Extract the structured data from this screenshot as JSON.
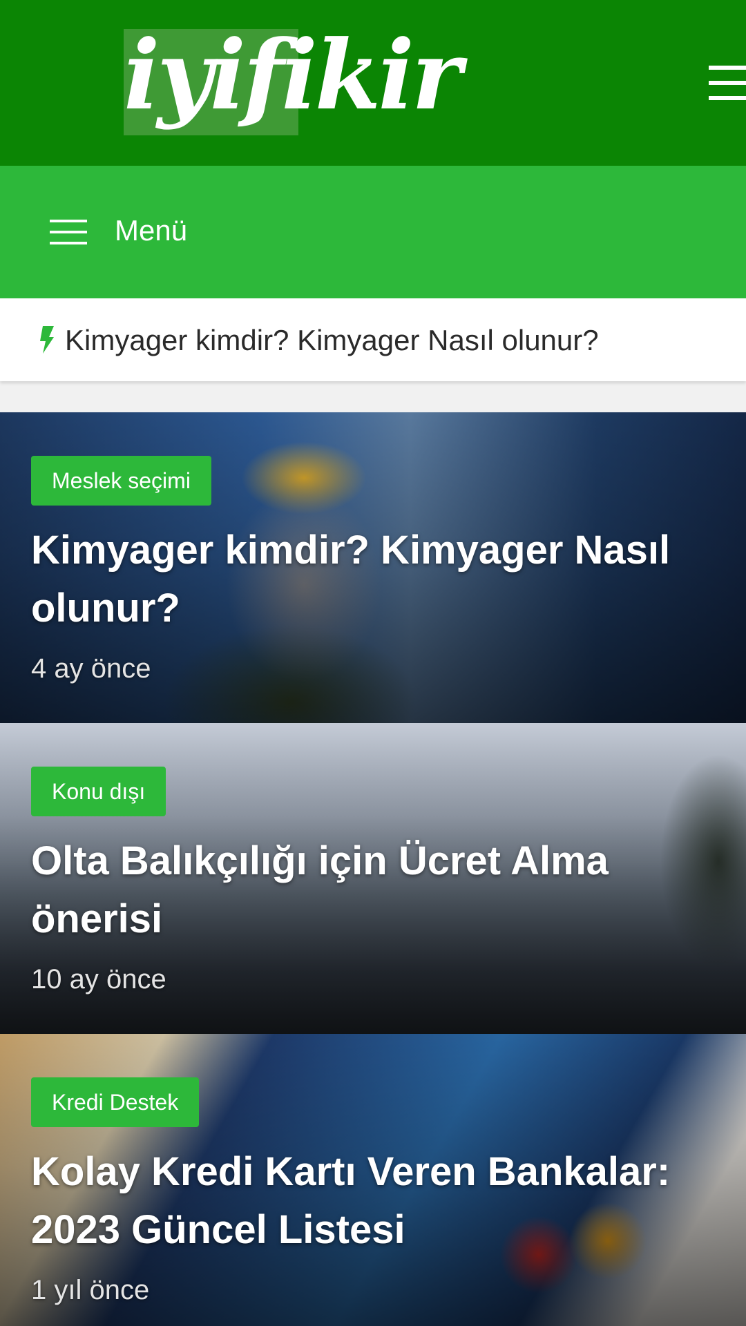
{
  "header": {
    "logo_text": "iyifikir",
    "menu_icon": "hamburger-icon"
  },
  "nav": {
    "menu_label": "Menü",
    "menu_icon": "hamburger-icon"
  },
  "breaking": {
    "icon": "lightning-bolt-icon",
    "text": "Kimyager kimdir? Kimyager Nasıl olunur?"
  },
  "posts": [
    {
      "category": "Meslek seçimi",
      "title": "Kimyager kimdir? Kimyager Nasıl olunur?",
      "date": "4 ay önce"
    },
    {
      "category": "Konu dışı",
      "title": "Olta Balıkçılığı için Ücret Alma önerisi",
      "date": "10 ay önce"
    },
    {
      "category": "Kredi Destek",
      "title": "Kolay Kredi Kartı Veren Bankalar: 2023 Güncel Listesi",
      "date": "1 yıl önce"
    }
  ],
  "colors": {
    "header_bg": "#0b8504",
    "nav_bg": "#2db83a",
    "badge_bg": "#2db83a",
    "bolt": "#2db83a"
  }
}
